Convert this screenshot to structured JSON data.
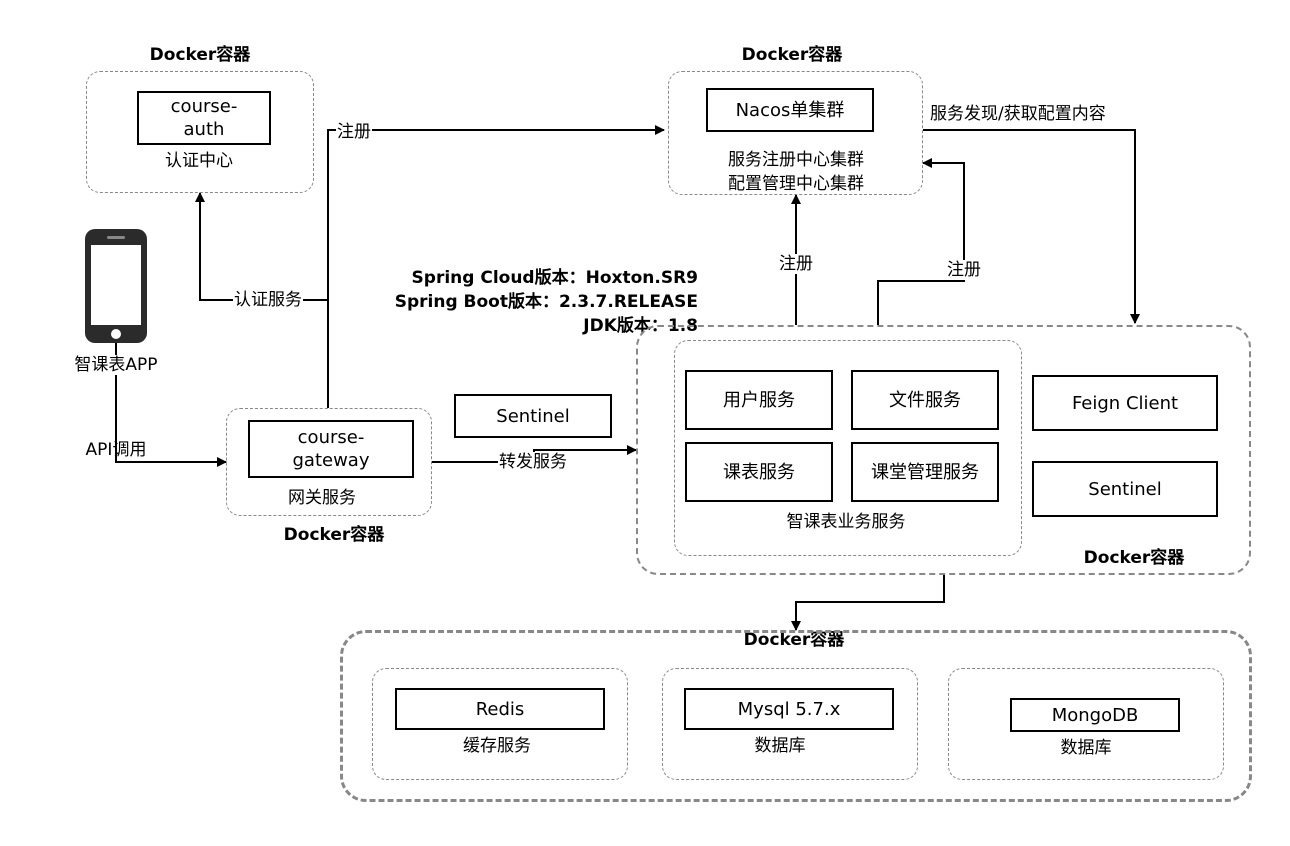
{
  "auth": {
    "container_title": "Docker容器",
    "service_name": "course-\nauth",
    "caption": "认证中心"
  },
  "nacos": {
    "container_title": "Docker容器",
    "service_name": "Nacos单集群",
    "caption_line1": "服务注册中心集群",
    "caption_line2": "配置管理中心集群"
  },
  "phone": {
    "label": "智课表APP"
  },
  "gateway": {
    "service_name": "course-\ngateway",
    "caption": "网关服务",
    "container_title": "Docker容器"
  },
  "gateway_sentinel": {
    "label": "Sentinel"
  },
  "versions": {
    "line1": "Spring Cloud版本：Hoxton.SR9",
    "line2": "Spring Boot版本：2.3.7.RELEASE",
    "line3": "JDK版本：1.8"
  },
  "business": {
    "container_title": "Docker容器",
    "group_caption": "智课表业务服务",
    "services": [
      "用户服务",
      "文件服务",
      "课表服务",
      "课堂管理服务"
    ],
    "feign_client": "Feign Client",
    "sentinel": "Sentinel"
  },
  "storage": {
    "container_title": "Docker容器",
    "items": [
      {
        "name": "Redis",
        "caption": "缓存服务"
      },
      {
        "name": "Mysql 5.7.x",
        "caption": "数据库"
      },
      {
        "name": "MongoDB",
        "caption": "数据库"
      }
    ]
  },
  "edges": {
    "register_gateway": "注册",
    "auth_service": "认证服务",
    "api_call": "API调用",
    "forward_service": "转发服务",
    "register_business_1": "注册",
    "register_business_2": "注册",
    "discovery_config": "服务发现/获取配置内容"
  }
}
